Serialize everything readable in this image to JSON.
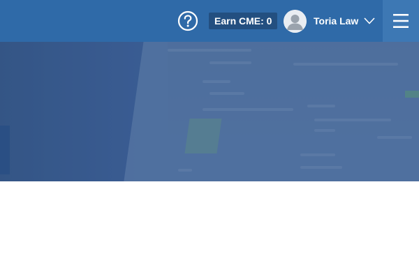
{
  "header": {
    "help_icon": "question-circle-icon",
    "cme_label": "Earn CME: 0",
    "user": {
      "name": "Toria Law",
      "avatar_icon": "user-silhouette-icon",
      "dropdown_icon": "chevron-down-icon"
    },
    "menu_icon": "hamburger-menu-icon"
  },
  "colors": {
    "header_bg": "#2f6aa8",
    "cme_badge_bg": "#234f80",
    "menu_button_bg": "#3d78b4",
    "hero_tint": "#476896",
    "content_bg": "#ffffff"
  }
}
